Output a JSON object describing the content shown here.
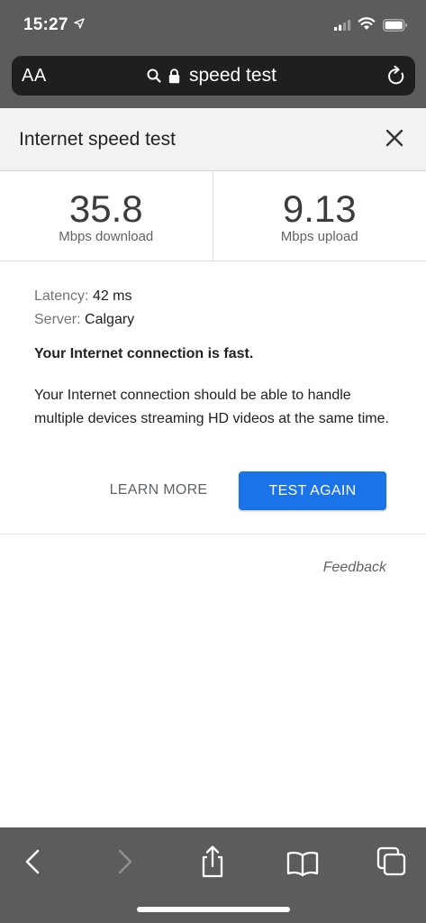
{
  "status_bar": {
    "time": "15:27"
  },
  "browser": {
    "text_size_label": "AA",
    "url_text": "speed test"
  },
  "card": {
    "title": "Internet speed test",
    "download": {
      "value": "35.8",
      "label": "Mbps download"
    },
    "upload": {
      "value": "9.13",
      "label": "Mbps upload"
    },
    "latency": {
      "key": "Latency:",
      "value": "42 ms"
    },
    "server": {
      "key": "Server:",
      "value": "Calgary"
    },
    "headline": "Your Internet connection is fast.",
    "description": "Your Internet connection should be able to handle multiple devices streaming HD videos at the same time.",
    "learn_more_label": "LEARN MORE",
    "test_again_label": "TEST AGAIN",
    "feedback_label": "Feedback"
  },
  "colors": {
    "accent": "#1a73e8",
    "chrome": "#5c5c5c",
    "url_bar": "#1f1f1f"
  },
  "toolbar_icons": [
    "back-icon",
    "forward-icon",
    "share-icon",
    "bookmarks-icon",
    "tabs-icon"
  ]
}
